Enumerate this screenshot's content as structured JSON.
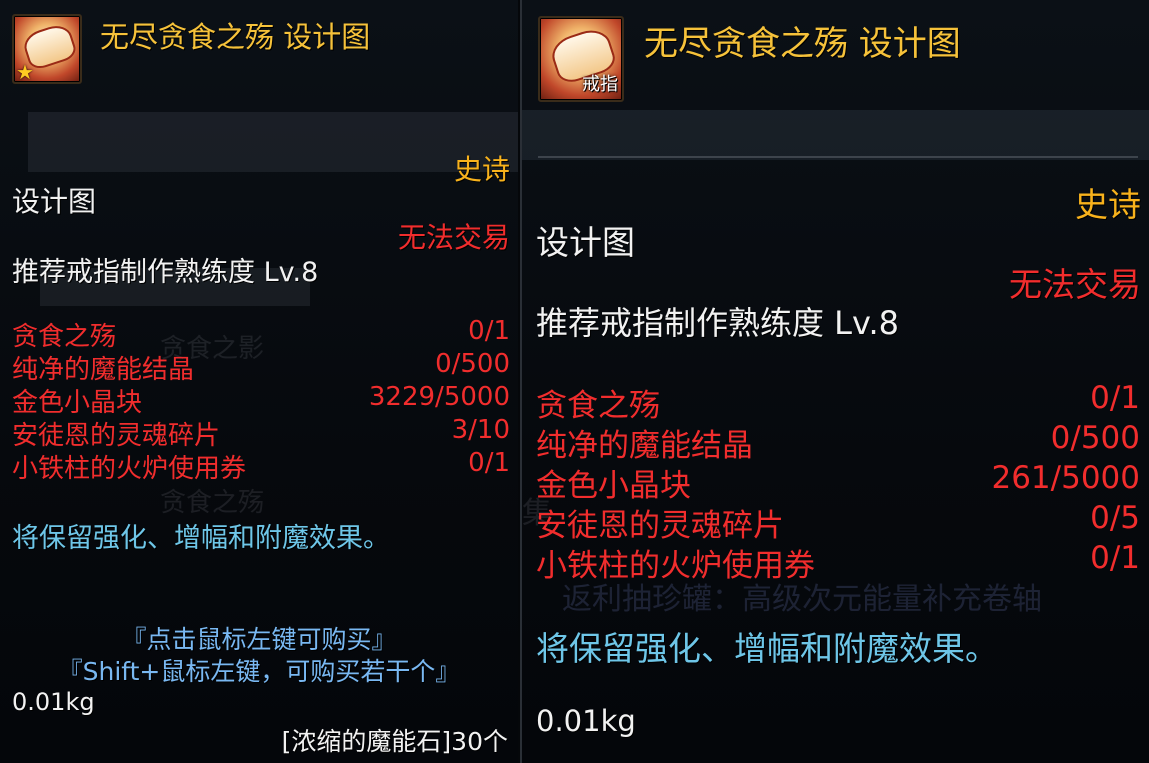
{
  "left": {
    "title": "无尽贪食之殇  设计图",
    "rarity": "史诗",
    "item_type": "设计图",
    "trade": "无法交易",
    "recommend": "推荐戒指制作熟练度 Lv.8",
    "materials": [
      {
        "name": "贪食之殇",
        "count": "0/1"
      },
      {
        "name": "纯净的魔能结晶",
        "count": "0/500"
      },
      {
        "name": "金色小晶块",
        "count": "3229/5000"
      },
      {
        "name": "安徒恩的灵魂碎片",
        "count": "3/10"
      },
      {
        "name": "小铁柱的火炉使用券",
        "count": "0/1"
      }
    ],
    "note": "将保留强化、增幅和附魔效果。",
    "buy_hint_1": "『点击鼠标左键可购买』",
    "buy_hint_2": "『Shift+鼠标左键，可购买若干个』",
    "weight": "0.01kg",
    "price": "[浓缩的魔能石]30个"
  },
  "right": {
    "title": "无尽贪食之殇  设计图",
    "icon_tag": "戒指",
    "rarity": "史诗",
    "item_type": "设计图",
    "trade": "无法交易",
    "recommend": "推荐戒指制作熟练度 Lv.8",
    "materials": [
      {
        "name": "贪食之殇",
        "count": "0/1"
      },
      {
        "name": "纯净的魔能结晶",
        "count": "0/500"
      },
      {
        "name": "金色小晶块",
        "count": "261/5000"
      },
      {
        "name": "安徒恩的灵魂碎片",
        "count": "0/5"
      },
      {
        "name": "小铁柱的火炉使用券",
        "count": "0/1"
      }
    ],
    "note": "将保留强化、增幅和附魔效果。",
    "weight": "0.01kg"
  },
  "colors": {
    "title": "#f6c23a",
    "rarity": "#f8b21c",
    "warning": "#f12d2d",
    "note": "#6ec6e8",
    "text": "#f2f2f2"
  }
}
